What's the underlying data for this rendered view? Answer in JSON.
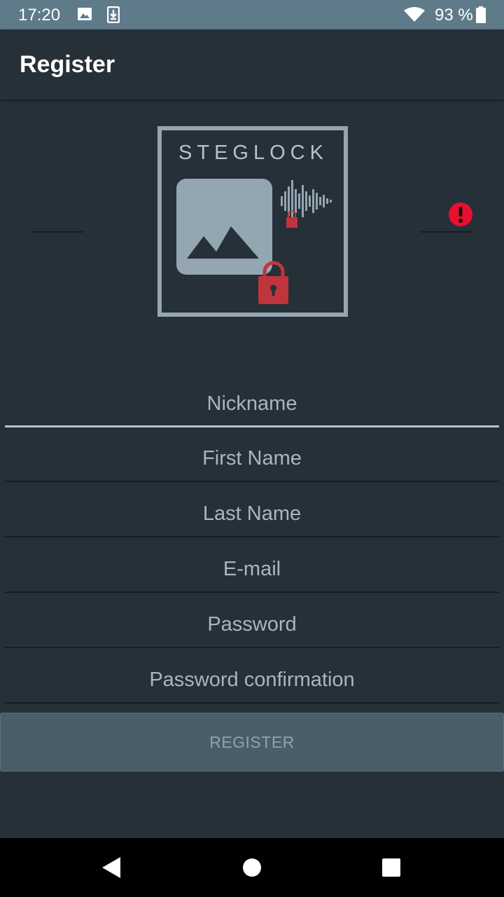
{
  "status_bar": {
    "time": "17:20",
    "battery": "93 %",
    "icons": [
      "image-icon",
      "download-icon",
      "wifi-icon",
      "battery-icon"
    ]
  },
  "app_bar": {
    "title": "Register"
  },
  "logo": {
    "text": "STEGLOCK"
  },
  "form": {
    "fields": [
      {
        "placeholder": "Nickname"
      },
      {
        "placeholder": "First Name"
      },
      {
        "placeholder": "Last Name"
      },
      {
        "placeholder": "E-mail"
      },
      {
        "placeholder": "Password"
      },
      {
        "placeholder": "Password confirmation"
      }
    ],
    "submit_label": "REGISTER"
  },
  "colors": {
    "background": "#263039",
    "status_bar": "#5f7b8a",
    "accent_red": "#c0343c",
    "error_red": "#e8102e",
    "logo_gray": "#93a6b1"
  },
  "nav_bar": {
    "icons": [
      "back-icon",
      "home-icon",
      "recents-icon"
    ]
  }
}
